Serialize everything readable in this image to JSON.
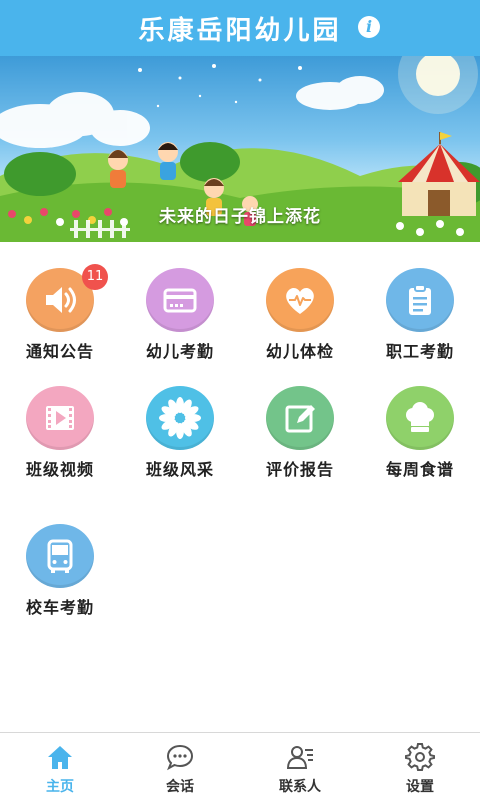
{
  "header": {
    "title": "乐康岳阳幼儿园",
    "info_icon": "info-icon"
  },
  "banner": {
    "caption": "未来的日子锦上添花"
  },
  "tiles": [
    {
      "label": "通知公告",
      "icon": "speaker-icon",
      "color": "#f4a261",
      "badge": "11"
    },
    {
      "label": "幼儿考勤",
      "icon": "card-icon",
      "color": "#d59be0",
      "badge": ""
    },
    {
      "label": "幼儿体检",
      "icon": "heart-pulse-icon",
      "color": "#f7a35a",
      "badge": ""
    },
    {
      "label": "职工考勤",
      "icon": "clipboard-icon",
      "color": "#6fb7e8",
      "badge": ""
    },
    {
      "label": "班级视频",
      "icon": "video-icon",
      "color": "#f3a7c0",
      "badge": ""
    },
    {
      "label": "班级风采",
      "icon": "flower-icon",
      "color": "#4fc0e6",
      "badge": ""
    },
    {
      "label": "评价报告",
      "icon": "edit-icon",
      "color": "#73c48a",
      "badge": ""
    },
    {
      "label": "每周食谱",
      "icon": "chef-hat-icon",
      "color": "#8fd16a",
      "badge": ""
    },
    {
      "label": "校车考勤",
      "icon": "bus-icon",
      "color": "#6fb7e8",
      "badge": ""
    }
  ],
  "nav": [
    {
      "label": "主页",
      "icon": "home-icon",
      "active": true
    },
    {
      "label": "会话",
      "icon": "chat-icon",
      "active": false
    },
    {
      "label": "联系人",
      "icon": "contacts-icon",
      "active": false
    },
    {
      "label": "设置",
      "icon": "gear-icon",
      "active": false
    }
  ],
  "colors": {
    "accent": "#4ab4ec",
    "badge": "#f0524d"
  }
}
